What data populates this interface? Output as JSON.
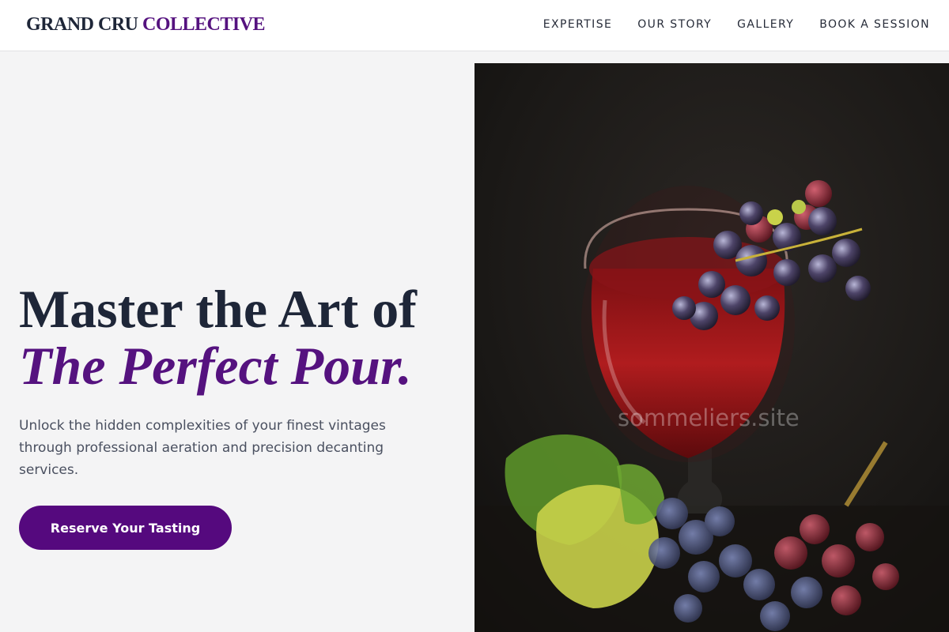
{
  "header": {
    "brand_primary": "GRAND CRU",
    "brand_accent": "COLLECTIVE",
    "nav": [
      "EXPERTISE",
      "OUR STORY",
      "GALLERY",
      "BOOK A SESSION"
    ]
  },
  "hero": {
    "headline_line1": "Master the Art of",
    "headline_line2": "The Perfect Pour.",
    "subtext": "Unlock the hidden complexities of your finest vintages through professional aeration and precision decanting services.",
    "cta_label": "Reserve Your Tasting",
    "image": {
      "subject": "red wine glass with grapes and vine leaves",
      "watermark": "sommeliers.site"
    }
  },
  "colors": {
    "accent": "#55127f",
    "button": "#55097e",
    "heading": "#1e2638",
    "background": "#f4f4f5"
  }
}
